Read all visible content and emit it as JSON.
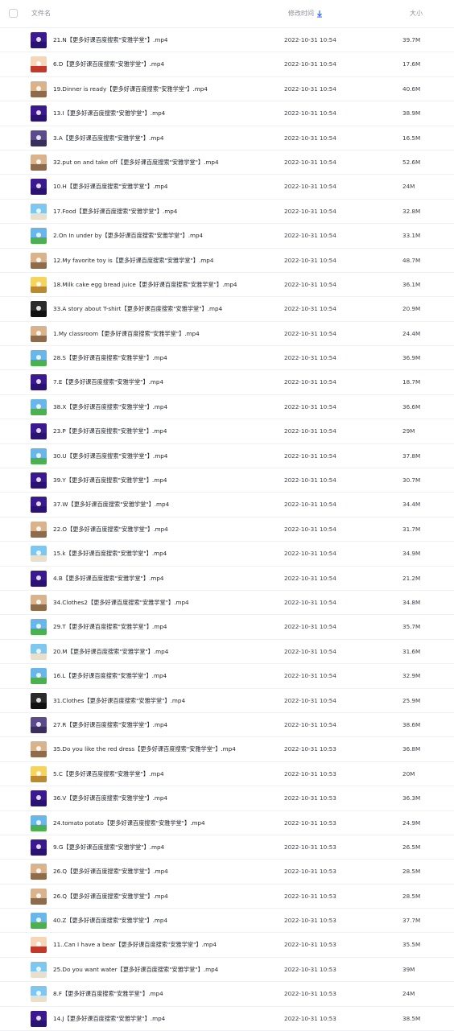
{
  "header": {
    "name_label": "文件名",
    "time_label": "修改时间",
    "size_label": "大小",
    "sort_color": "#2f6bff"
  },
  "files": [
    {
      "name": "21.N【更多好课百度搜索\"安雅学堂\"】.mp4",
      "time": "2022-10-31 10:54",
      "size": "39.7M",
      "thumb": "purple"
    },
    {
      "name": "6.D【更多好课百度搜索\"安雅学堂\"】.mp4",
      "time": "2022-10-31 10:54",
      "size": "17.6M",
      "thumb": "cartoon"
    },
    {
      "name": "19.Dinner is ready【更多好课百度搜索\"安雅学堂\"】.mp4",
      "time": "2022-10-31 10:54",
      "size": "40.6M",
      "thumb": "room"
    },
    {
      "name": "13.I【更多好课百度搜索\"安雅学堂\"】.mp4",
      "time": "2022-10-31 10:54",
      "size": "38.9M",
      "thumb": "purple"
    },
    {
      "name": "3.A【更多好课百度搜索\"安雅学堂\"】.mp4",
      "time": "2022-10-31 10:54",
      "size": "16.5M",
      "thumb": "dusk"
    },
    {
      "name": "32.put on and take off【更多好课百度搜索\"安雅学堂\"】.mp4",
      "time": "2022-10-31 10:54",
      "size": "52.6M",
      "thumb": "room"
    },
    {
      "name": "10.H【更多好课百度搜索\"安雅学堂\"】.mp4",
      "time": "2022-10-31 10:54",
      "size": "24M",
      "thumb": "purple"
    },
    {
      "name": "17.Food【更多好课百度搜索\"安雅学堂\"】.mp4",
      "time": "2022-10-31 10:54",
      "size": "32.8M",
      "thumb": "sky"
    },
    {
      "name": "2.On In under by【更多好课百度搜索\"安雅学堂\"】.mp4",
      "time": "2022-10-31 10:54",
      "size": "33.1M",
      "thumb": "grass"
    },
    {
      "name": "12.My favorite toy is【更多好课百度搜索\"安雅学堂\"】.mp4",
      "time": "2022-10-31 10:54",
      "size": "48.7M",
      "thumb": "room"
    },
    {
      "name": "18.Milk cake egg bread juice【更多好课百度搜索\"安雅学堂\"】.mp4",
      "time": "2022-10-31 10:54",
      "size": "36.1M",
      "thumb": "yellow"
    },
    {
      "name": "33.A story about T-shirt【更多好课百度搜索\"安雅学堂\"】.mp4",
      "time": "2022-10-31 10:54",
      "size": "20.9M",
      "thumb": "dark"
    },
    {
      "name": "1.My classroom【更多好课百度搜索\"安雅学堂\"】.mp4",
      "time": "2022-10-31 10:54",
      "size": "24.4M",
      "thumb": "room"
    },
    {
      "name": "28.S【更多好课百度搜索\"安雅学堂\"】.mp4",
      "time": "2022-10-31 10:54",
      "size": "36.9M",
      "thumb": "grass"
    },
    {
      "name": "7.E【更多好课百度搜索\"安雅学堂\"】.mp4",
      "time": "2022-10-31 10:54",
      "size": "18.7M",
      "thumb": "purple"
    },
    {
      "name": "38.X【更多好课百度搜索\"安雅学堂\"】.mp4",
      "time": "2022-10-31 10:54",
      "size": "36.6M",
      "thumb": "grass"
    },
    {
      "name": "23.P【更多好课百度搜索\"安雅学堂\"】.mp4",
      "time": "2022-10-31 10:54",
      "size": "29M",
      "thumb": "purple"
    },
    {
      "name": "30.U【更多好课百度搜索\"安雅学堂\"】.mp4",
      "time": "2022-10-31 10:54",
      "size": "37.8M",
      "thumb": "grass"
    },
    {
      "name": "39.Y【更多好课百度搜索\"安雅学堂\"】.mp4",
      "time": "2022-10-31 10:54",
      "size": "30.7M",
      "thumb": "purple"
    },
    {
      "name": "37.W【更多好课百度搜索\"安雅学堂\"】.mp4",
      "time": "2022-10-31 10:54",
      "size": "34.4M",
      "thumb": "purple"
    },
    {
      "name": "22.O【更多好课百度搜索\"安雅学堂\"】.mp4",
      "time": "2022-10-31 10:54",
      "size": "31.7M",
      "thumb": "room"
    },
    {
      "name": "15.k【更多好课百度搜索\"安雅学堂\"】.mp4",
      "time": "2022-10-31 10:54",
      "size": "34.9M",
      "thumb": "sky"
    },
    {
      "name": "4.B【更多好课百度搜索\"安雅学堂\"】.mp4",
      "time": "2022-10-31 10:54",
      "size": "21.2M",
      "thumb": "purple"
    },
    {
      "name": "34.Clothes2【更多好课百度搜索\"安雅学堂\"】.mp4",
      "time": "2022-10-31 10:54",
      "size": "34.8M",
      "thumb": "room"
    },
    {
      "name": "29.T【更多好课百度搜索\"安雅学堂\"】.mp4",
      "time": "2022-10-31 10:54",
      "size": "35.7M",
      "thumb": "grass"
    },
    {
      "name": "20.M【更多好课百度搜索\"安雅学堂\"】.mp4",
      "time": "2022-10-31 10:54",
      "size": "31.6M",
      "thumb": "sky"
    },
    {
      "name": "16.L【更多好课百度搜索\"安雅学堂\"】.mp4",
      "time": "2022-10-31 10:54",
      "size": "32.9M",
      "thumb": "grass"
    },
    {
      "name": "31.Clothes【更多好课百度搜索\"安雅学堂\"】.mp4",
      "time": "2022-10-31 10:54",
      "size": "25.9M",
      "thumb": "dark"
    },
    {
      "name": "27.R【更多好课百度搜索\"安雅学堂\"】.mp4",
      "time": "2022-10-31 10:54",
      "size": "38.6M",
      "thumb": "dusk"
    },
    {
      "name": "35.Do you like the red dress【更多好课百度搜索\"安雅学堂\"】.mp4",
      "time": "2022-10-31 10:53",
      "size": "36.8M",
      "thumb": "room"
    },
    {
      "name": "5.C【更多好课百度搜索\"安雅学堂\"】.mp4",
      "time": "2022-10-31 10:53",
      "size": "20M",
      "thumb": "yellow"
    },
    {
      "name": "36.V【更多好课百度搜索\"安雅学堂\"】.mp4",
      "time": "2022-10-31 10:53",
      "size": "36.3M",
      "thumb": "purple"
    },
    {
      "name": "24.tomato potato【更多好课百度搜索\"安雅学堂\"】.mp4",
      "time": "2022-10-31 10:53",
      "size": "24.9M",
      "thumb": "grass"
    },
    {
      "name": "9.G【更多好课百度搜索\"安雅学堂\"】.mp4",
      "time": "2022-10-31 10:53",
      "size": "26.5M",
      "thumb": "purple"
    },
    {
      "name": "26.Q【更多好课百度搜索\"安雅学堂\"】.mp4",
      "time": "2022-10-31 10:53",
      "size": "28.5M",
      "thumb": "room"
    },
    {
      "name": "26.Q【更多好课百度搜索\"安雅学堂\"】.mp4",
      "time": "2022-10-31 10:53",
      "size": "28.5M",
      "thumb": "room"
    },
    {
      "name": "40.Z【更多好课百度搜索\"安雅学堂\"】.mp4",
      "time": "2022-10-31 10:53",
      "size": "37.7M",
      "thumb": "grass"
    },
    {
      "name": "11..Can I have a bear【更多好课百度搜索\"安雅学堂\"】.mp4",
      "time": "2022-10-31 10:53",
      "size": "35.5M",
      "thumb": "cartoon"
    },
    {
      "name": "25.Do you want water【更多好课百度搜索\"安雅学堂\"】.mp4",
      "time": "2022-10-31 10:53",
      "size": "39M",
      "thumb": "sky"
    },
    {
      "name": "8.F【更多好课百度搜索\"安雅学堂\"】.mp4",
      "time": "2022-10-31 10:53",
      "size": "24M",
      "thumb": "sky"
    },
    {
      "name": "14.J【更多好课百度搜索\"安雅学堂\"】.mp4",
      "time": "2022-10-31 10:53",
      "size": "38.5M",
      "thumb": "purple"
    }
  ],
  "thumb_colors": {
    "purple": [
      "#3b1a8f",
      "#2a1270"
    ],
    "cartoon": [
      "#f5d6b8",
      "#c0392b"
    ],
    "room": [
      "#d9b38c",
      "#8e6b4a"
    ],
    "dusk": [
      "#5b4b8a",
      "#3a2f5c"
    ],
    "sky": [
      "#7ec8f0",
      "#e8e0cc"
    ],
    "grass": [
      "#69b7ea",
      "#4caf50"
    ],
    "yellow": [
      "#f4d35e",
      "#b98a2f"
    ],
    "dark": [
      "#2b2b2b",
      "#111111"
    ]
  }
}
